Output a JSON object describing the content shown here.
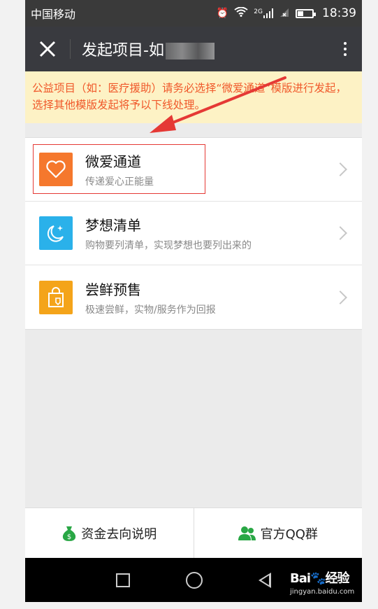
{
  "status_bar": {
    "carrier": "中国移动",
    "network": "2G",
    "time": "18:39"
  },
  "header": {
    "title": "发起项目-如"
  },
  "notice": "公益项目（如：医疗援助）请务必选择“微爱通道”模版进行发起，选择其他模版发起将予以下线处理。",
  "items": [
    {
      "title": "微爱通道",
      "subtitle": "传递爱心正能量",
      "icon": "heart-icon",
      "color": "#f5782d"
    },
    {
      "title": "梦想清单",
      "subtitle": "购物要列清单，实现梦想也要列出来的",
      "icon": "moon-star-icon",
      "color": "#2ab1ea"
    },
    {
      "title": "尝鲜预售",
      "subtitle": "极速尝鲜，实物/服务作为回报",
      "icon": "shopping-bag-icon",
      "color": "#f4a41a"
    }
  ],
  "bottom_tabs": [
    {
      "label": "资金去向说明",
      "icon": "money-bag-icon"
    },
    {
      "label": "官方QQ群",
      "icon": "group-icon"
    }
  ],
  "watermark": {
    "brand": "Bai",
    "brand_suffix": "经验",
    "url": "jingyan.baidu.com"
  }
}
